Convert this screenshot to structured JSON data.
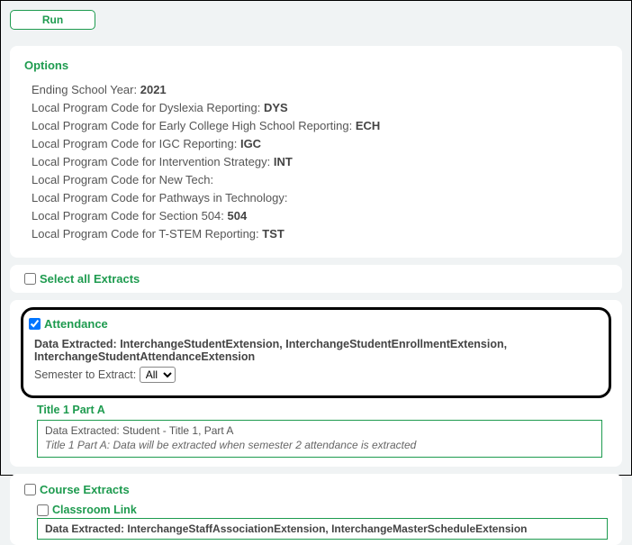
{
  "toolbar": {
    "run_label": "Run"
  },
  "options": {
    "heading": "Options",
    "rows": [
      {
        "label": "Ending School Year:",
        "value": "2021"
      },
      {
        "label": "Local Program Code for Dyslexia Reporting:",
        "value": "DYS"
      },
      {
        "label": "Local Program Code for Early College High School Reporting:",
        "value": "ECH"
      },
      {
        "label": "Local Program Code for IGC Reporting:",
        "value": "IGC"
      },
      {
        "label": "Local Program Code for Intervention Strategy:",
        "value": "INT"
      },
      {
        "label": "Local Program Code for New Tech:",
        "value": ""
      },
      {
        "label": "Local Program Code for Pathways in Technology:",
        "value": ""
      },
      {
        "label": "Local Program Code for Section 504:",
        "value": "504"
      },
      {
        "label": "Local Program Code for T-STEM Reporting:",
        "value": "TST"
      }
    ]
  },
  "select_all": {
    "label": "Select all Extracts",
    "checked": false
  },
  "attendance": {
    "label": "Attendance",
    "checked": true,
    "data_extracted_label": "Data Extracted:",
    "data_extracted_value": "InterchangeStudentExtension, InterchangeStudentEnrollmentExtension, InterchangeStudentAttendanceExtension",
    "semester_label": "Semester to Extract:",
    "semester_value": "All",
    "title1": {
      "heading": "Title 1 Part A",
      "data_extracted": "Data Extracted: Student - Title 1, Part A",
      "note": "Title 1 Part A: Data will be extracted when semester 2 attendance is extracted"
    }
  },
  "course": {
    "label": "Course Extracts",
    "checked": false,
    "classroom": {
      "label": "Classroom Link",
      "checked": false,
      "data_extracted_label": "Data Extracted:",
      "data_extracted_value": "InterchangeStaffAssociationExtension, InterchangeMasterScheduleExtension"
    }
  }
}
